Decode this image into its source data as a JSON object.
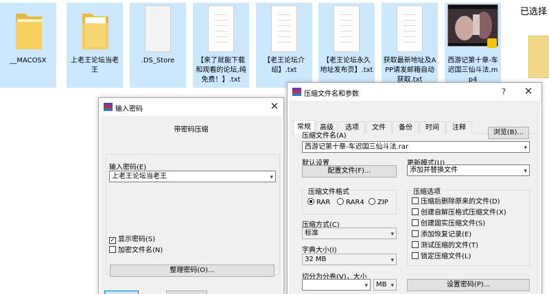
{
  "explorer": {
    "right_header": "已选择",
    "files": [
      {
        "name": "__MACOSX",
        "kind": "folder"
      },
      {
        "name": "上老王论坛当老王",
        "kind": "folder"
      },
      {
        "name": ".DS_Store",
        "kind": "file"
      },
      {
        "name": "【来了就能下载和观看的论坛,纯免费！】.txt",
        "kind": "text"
      },
      {
        "name": "【老王论坛介绍】.txt",
        "kind": "text"
      },
      {
        "name": "【老王论坛永久地址发布页】.txt",
        "kind": "text"
      },
      {
        "name": "获取最新地址及APP请发邮箱自动获取.txt",
        "kind": "text"
      },
      {
        "name": "西游记第十章-车迟国三仙斗法.mp4",
        "kind": "video"
      }
    ]
  },
  "password_dialog": {
    "title": "输入密码",
    "heading": "带密码压缩",
    "input_label": "输入密码(E)",
    "password_value": "上老王论坛当老王",
    "show_password_label": "显示密码(S)",
    "show_password_checked": true,
    "encrypt_names_label": "加密文件名(N)",
    "encrypt_names_checked": false,
    "organize_button": "整理密码(O)..."
  },
  "archive_dialog": {
    "title": "压缩文件名和参数",
    "help": "?",
    "tabs": [
      "常规",
      "高级",
      "选项",
      "文件",
      "备份",
      "时间",
      "注释"
    ],
    "active_tab": 0,
    "archive_name_label": "压缩文件名(A)",
    "browse_button": "浏览(B)...",
    "archive_name_value": "西游记第十章-车迟国三仙斗法.rar",
    "default_settings_label": "默认设置",
    "profiles_button": "配置文件(F)...",
    "update_mode_label": "更新模式(U)",
    "update_mode_value": "添加并替换文件",
    "format_group": "压缩文件格式",
    "formats": [
      "RAR",
      "RAR4",
      "ZIP"
    ],
    "selected_format": "RAR",
    "options_group": "压缩选项",
    "options": [
      {
        "label": "压缩后删除原来的文件(D)",
        "checked": false
      },
      {
        "label": "创建自解压格式压缩文件(X)",
        "checked": false
      },
      {
        "label": "创建固实压缩文件(S)",
        "checked": false
      },
      {
        "label": "添加恢复记录(E)",
        "checked": false
      },
      {
        "label": "测试压缩的文件(T)",
        "checked": false
      },
      {
        "label": "锁定压缩文件(L)",
        "checked": false
      }
    ],
    "method_label": "压缩方式(C)",
    "method_value": "标准",
    "dict_label": "字典大小(I)",
    "dict_value": "32 MB",
    "split_label": "切分为分卷(V)，大小",
    "split_value": "",
    "split_unit": "MB",
    "set_password_button": "设置密码(P)..."
  },
  "colors": {
    "selection": "#cce8ff",
    "dialog_bg": "#f0f0f0",
    "folder": "#f7cf5c",
    "accent_blue": "#0078d7"
  }
}
